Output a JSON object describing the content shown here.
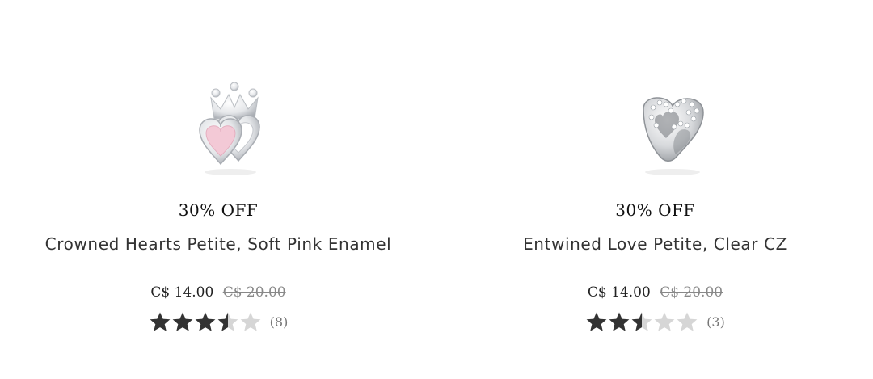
{
  "products": [
    {
      "discount": "30% OFF",
      "title": "Crowned Hearts Petite, Soft Pink Enamel",
      "price": "C$ 14.00",
      "original_price": "C$ 20.00",
      "rating": 3.5,
      "review_count": "(8)",
      "image_icon": "crowned-hearts-charm"
    },
    {
      "discount": "30% OFF",
      "title": "Entwined Love Petite, Clear CZ",
      "price": "C$ 14.00",
      "original_price": "C$ 20.00",
      "rating": 2.5,
      "review_count": "(3)",
      "image_icon": "entwined-love-charm"
    }
  ],
  "colors": {
    "star_filled": "#333333",
    "star_empty": "#d6d6d6",
    "divider": "#e6e6e6",
    "enamel_pink": "#f3c9d6",
    "silver": "#c9ccd0"
  }
}
